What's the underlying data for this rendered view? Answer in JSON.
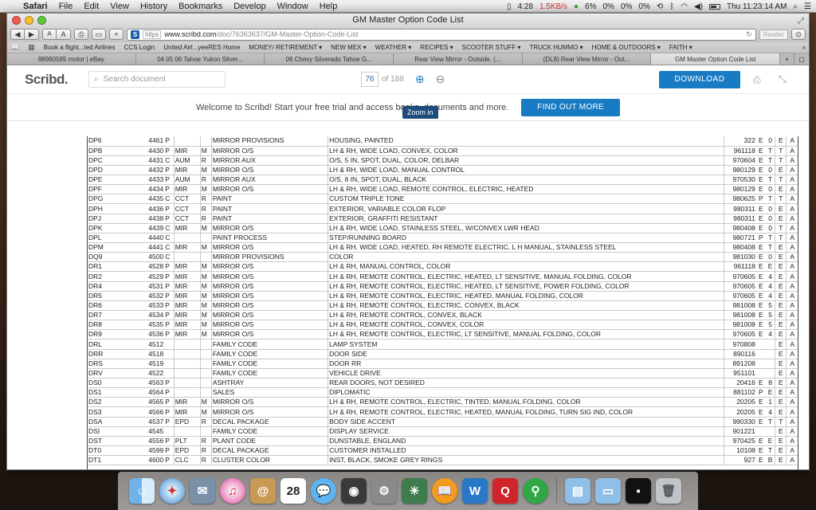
{
  "menubar": {
    "app": "Safari",
    "items": [
      "File",
      "Edit",
      "View",
      "History",
      "Bookmarks",
      "Develop",
      "Window",
      "Help"
    ],
    "status": {
      "time_small": "4:28",
      "net": "1.5KB/s",
      "pct1": "6%",
      "pct2": "0%",
      "pct3": "0%",
      "pct4": "0%",
      "clock": "Thu 11:23:14 AM"
    }
  },
  "window": {
    "title": "GM Master Option Code List"
  },
  "toolbar": {
    "back": "◀",
    "forward": "▶",
    "font_small": "A",
    "font_large": "A",
    "new_tab": "+",
    "https": "https",
    "url_host": "www.scribd.com",
    "url_path": "/doc/76363637/GM-Master-Option-Code-List",
    "reader": "Reader"
  },
  "bookmarks": [
    "Book a flight...ted Airlines",
    "CCS Login",
    "United Airl...yeeRES Home",
    "MONEY/ RETIREMENT ▾",
    "NEW MEX ▾",
    "WEATHER ▾",
    "RECIPES ▾",
    "SCOOTER STUFF ▾",
    "TRUCK HUMMO ▾",
    "HOME & OUTDOORS ▾",
    "FAITH ▾"
  ],
  "tabs": [
    "88980585 motor | eBay",
    "04 05 06 Tahoe Yukon Silver...",
    "06 Chevy Silverado Tahoe G...",
    "Rear View Mirror - Outside. (...",
    "(DL8) Rear View Mirror - Out...",
    "GM Master Option Code List"
  ],
  "scribd": {
    "logo": "Scribd.",
    "search_placeholder": "Search document",
    "page_current": "76",
    "page_total": "of 188",
    "download": "DOWNLOAD",
    "tooltip": "Zoom in",
    "welcome": "Welcome to Scribd! Start your free trial and access books, documents and more.",
    "find_more": "FIND OUT MORE"
  },
  "rows": [
    [
      "DP6",
      "4461",
      "P",
      "",
      "",
      "MIRROR PROVISIONS",
      "HOUSING, PAINTED",
      "322",
      "E",
      "0",
      "E",
      "A"
    ],
    [
      "DPB",
      "4430",
      "P",
      "MIR",
      "M",
      "MIRROR O/S",
      "LH & RH, WIDE LOAD, CONVEX, COLOR",
      "961118",
      "E",
      "T",
      "T",
      "A"
    ],
    [
      "DPC",
      "4431",
      "C",
      "AUM",
      "R",
      "MIRROR AUX",
      "O/S, 5 IN, SPOT, DUAL, COLOR, DELBAR",
      "970604",
      "E",
      "T",
      "T",
      "A"
    ],
    [
      "DPD",
      "4432",
      "P",
      "MIR",
      "M",
      "MIRROR O/S",
      "LH & RH, WIDE LOAD, MANUAL CONTROL",
      "980129",
      "E",
      "0",
      "E",
      "A"
    ],
    [
      "DPE",
      "4433",
      "P",
      "AUM",
      "R",
      "MIRROR AUX",
      "O/S, 8 IN, SPOT, DUAL, BLACK",
      "970530",
      "E",
      "T",
      "T",
      "A"
    ],
    [
      "DPF",
      "4434",
      "P",
      "MIR",
      "M",
      "MIRROR O/S",
      "LH & RH, WIDE LOAD, REMOTE CONTROL, ELECTRIC,      HEATED",
      "980129",
      "E",
      "0",
      "E",
      "A"
    ],
    [
      "DPG",
      "4435",
      "C",
      "CCT",
      "R",
      "PAINT",
      "CUSTOM TRIPLE TONE",
      "980625",
      "P",
      "T",
      "T",
      "A"
    ],
    [
      "DPH",
      "4436",
      "P",
      "CCT",
      "R",
      "PAINT",
      "EXTERIOR, VARIABLE COLOR FLOP",
      "980311",
      "E",
      "0",
      "E",
      "A"
    ],
    [
      "DPJ",
      "4438",
      "P",
      "CCT",
      "R",
      "PAINT",
      "EXTERIOR, GRAFFITI RESISTANT",
      "980311",
      "E",
      "0",
      "E",
      "A"
    ],
    [
      "DPK",
      "4439",
      "C",
      "MIR",
      "M",
      "MIRROR O/S",
      "LH & RH, WIDE LOAD, STAINLESS STEEL,              W/CONVEX LWR HEAD",
      "980408",
      "E",
      "0",
      "T",
      "A"
    ],
    [
      "DPL",
      "4440",
      "C",
      "",
      "",
      "PAINT PROCESS",
      "STEP/RUNNING BOARD",
      "980721",
      "P",
      "T",
      "T",
      "A"
    ],
    [
      "DPM",
      "4441",
      "C",
      "MIR",
      "M",
      "MIRROR O/S",
      "LH & RH, WIDE LOAD, HEATED, RH REMOTE ELECTRIC,   L  H MANUAL, STAINLESS STEEL",
      "980408",
      "E",
      "T",
      "E",
      "A"
    ],
    [
      "DQ9",
      "4500",
      "C",
      "",
      "",
      "MIRROR PROVISIONS",
      "COLOR",
      "981030",
      "E",
      "0",
      "E",
      "A"
    ],
    [
      "DR1",
      "4528",
      "P",
      "MIR",
      "M",
      "MIRROR O/S",
      "LH & RH, MANUAL CONTROL, COLOR",
      "961118",
      "E",
      "E",
      "E",
      "A"
    ],
    [
      "DR2",
      "4529",
      "P",
      "MIR",
      "M",
      "MIRROR O/S",
      "LH & RH, REMOTE CONTROL, ELECTRIC, HEATED,      LT SENSITIVE, MANUAL FOLDING, COLOR",
      "970605",
      "E",
      "4",
      "E",
      "A"
    ],
    [
      "DR4",
      "4531",
      "P",
      "MIR",
      "M",
      "MIRROR O/S",
      "LH & RH, REMOTE CONTROL, ELECTRIC, HEATED,      LT SENSITIVE, POWER FOLDING, COLOR",
      "970605",
      "E",
      "4",
      "E",
      "A"
    ],
    [
      "DR5",
      "4532",
      "P",
      "MIR",
      "M",
      "MIRROR O/S",
      "LH & RH, REMOTE CONTROL, ELECTRIC, HEATED,      MANUAL FOLDING, COLOR",
      "970605",
      "E",
      "4",
      "E",
      "A"
    ],
    [
      "DR6",
      "4533",
      "P",
      "MIR",
      "M",
      "MIRROR O/S",
      "LH & RH, REMOTE CONTROL, ELECTRIC, CONVEX, BLACK",
      "981008",
      "E",
      "5",
      "E",
      "A"
    ],
    [
      "DR7",
      "4534",
      "P",
      "MIR",
      "M",
      "MIRROR O/S",
      "LH & RH, REMOTE CONTROL, CONVEX, BLACK",
      "981008",
      "E",
      "5",
      "E",
      "A"
    ],
    [
      "DR8",
      "4535",
      "P",
      "MIR",
      "M",
      "MIRROR O/S",
      "LH & RH, REMOTE CONTROL, CONVEX, COLOR",
      "981008",
      "E",
      "5",
      "E",
      "A"
    ],
    [
      "DR9",
      "4536",
      "P",
      "MIR",
      "M",
      "MIRROR O/S",
      "LH & RH, REMOTE CONTROL, ELECTRIC, LT SENSITIVE,  MANUAL FOLDING, COLOR",
      "970605",
      "E",
      "4",
      "E",
      "A"
    ],
    [
      "DRL",
      "4512",
      "",
      "",
      "",
      "FAMILY CODE",
      "LAMP SYSTEM",
      "970808",
      "",
      "",
      "E",
      "A"
    ],
    [
      "DRR",
      "4518",
      "",
      "",
      "",
      "FAMILY CODE",
      "DOOR SIDE",
      "890116",
      "",
      "",
      "E",
      "A"
    ],
    [
      "DRS",
      "4519",
      "",
      "",
      "",
      "FAMILY CODE",
      "DOOR RR",
      "891208",
      "",
      "",
      "E",
      "A"
    ],
    [
      "DRV",
      "4522",
      "",
      "",
      "",
      "FAMILY CODE",
      "VEHICLE DRIVE",
      "951101",
      "",
      "",
      "E",
      "A"
    ],
    [
      "DS0",
      "4563",
      "P",
      "",
      "",
      "ASHTRAY",
      "REAR DOORS, NOT DESIRED",
      "20416",
      "E",
      "8",
      "E",
      "A"
    ],
    [
      "DS1",
      "4564",
      "P",
      "",
      "",
      "SALES",
      "DIPLOMATIC",
      "881102",
      "P",
      "E",
      "E",
      "A"
    ],
    [
      "DS2",
      "4565",
      "P",
      "MIR",
      "M",
      "MIRROR O/S",
      "LH & RH, REMOTE CONTROL, ELECTRIC, TINTED, MANUAL FOLDING, COLOR",
      "20205",
      "E",
      "1",
      "E",
      "A"
    ],
    [
      "DS3",
      "4566",
      "P",
      "MIR",
      "M",
      "MIRROR O/S",
      "LH & RH, REMOTE CONTROL, ELECTRIC, HEATED,      MANUAL FOLDING, TURN SIG IND, COLOR",
      "20205",
      "E",
      "4",
      "E",
      "A"
    ],
    [
      "DSA",
      "4537",
      "P",
      "EPD",
      "R",
      "DECAL PACKAGE",
      "BODY SIDE ACCENT",
      "990330",
      "E",
      "T",
      "T",
      "A"
    ],
    [
      "DSI",
      "4545",
      "",
      "",
      "",
      "FAMILY CODE",
      "DISPLAY SERVICE",
      "901221",
      "",
      "",
      "E",
      "A"
    ],
    [
      "DST",
      "4556",
      "P",
      "PLT",
      "R",
      "PLANT CODE",
      "DUNSTABLE, ENGLAND",
      "970425",
      "E",
      "E",
      "E",
      "A"
    ],
    [
      "DT0",
      "4599",
      "P",
      "EPD",
      "R",
      "DECAL PACKAGE",
      "CUSTOMER INSTALLED",
      "10108",
      "E",
      "T",
      "E",
      "A"
    ],
    [
      "DT1",
      "4600",
      "P",
      "CLC",
      "R",
      "CLUSTER COLOR",
      "INST, BLACK, SMOKE GREY RINGS",
      "927",
      "E",
      "B",
      "E",
      "A"
    ]
  ],
  "dock": [
    "Finder",
    "Safari",
    "Mail",
    "iTunes",
    "Contacts",
    "Calendar",
    "Messages",
    "FaceTime",
    "Preferences",
    "Photos",
    "iBooks",
    "Word",
    "Quicken",
    "Maps",
    "Applications",
    "Documents",
    "Downloads",
    "Trash"
  ],
  "colors": {
    "scribd_blue": "#1a7bc5",
    "tooltip": "#1e4d7b"
  }
}
